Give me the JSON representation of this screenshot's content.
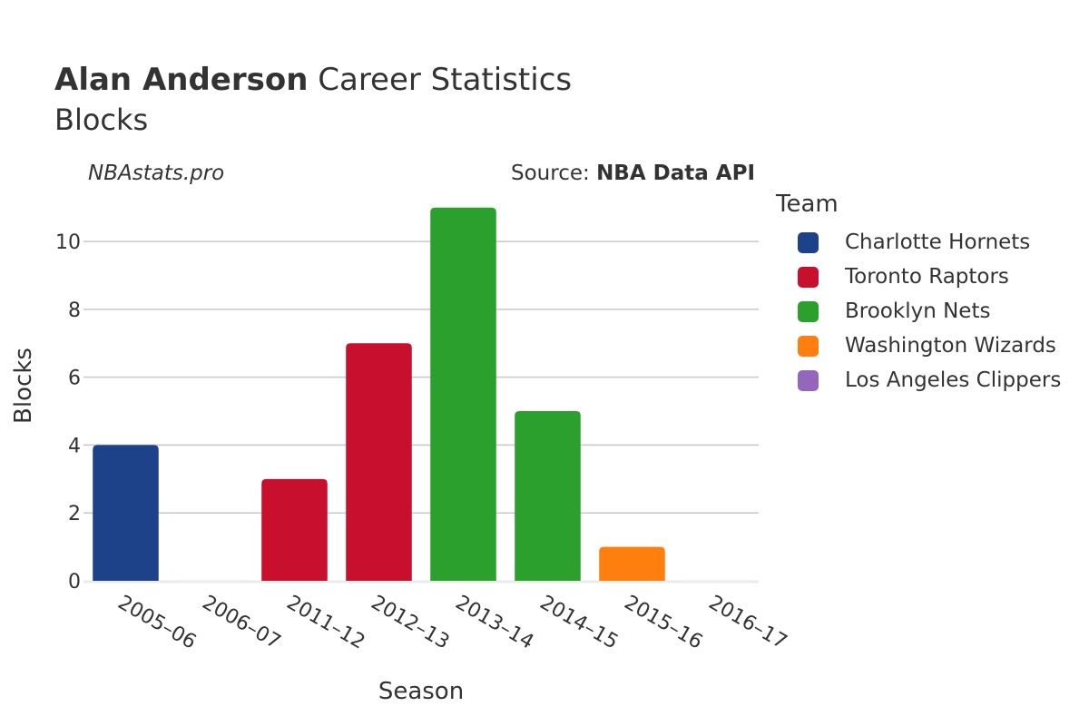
{
  "header": {
    "player": "Alan Anderson",
    "title_rest": " Career Statistics",
    "subtitle": "Blocks",
    "credit": "NBAstats.pro",
    "source_prefix": "Source: ",
    "source_name": "NBA Data API"
  },
  "legend": {
    "title": "Team",
    "items": [
      {
        "label": "Charlotte Hornets",
        "color": "#1d428a"
      },
      {
        "label": "Toronto Raptors",
        "color": "#c8102e"
      },
      {
        "label": "Brooklyn Nets",
        "color": "#2ca02c"
      },
      {
        "label": "Washington Wizards",
        "color": "#ff7f0e"
      },
      {
        "label": "Los Angeles Clippers",
        "color": "#9467bd"
      }
    ]
  },
  "chart_data": {
    "type": "bar",
    "title": "Alan Anderson Career Statistics",
    "subtitle": "Blocks",
    "xlabel": "Season",
    "ylabel": "Blocks",
    "ylim": [
      0,
      11.5
    ],
    "yticks": [
      0,
      2,
      4,
      6,
      8,
      10
    ],
    "grid": true,
    "legend_position": "right",
    "categories": [
      "2005–06",
      "2006–07",
      "2011–12",
      "2012–13",
      "2013–14",
      "2014–15",
      "2015–16",
      "2016–17"
    ],
    "values": [
      4,
      0,
      3,
      7,
      11,
      5,
      1,
      0
    ],
    "teams": [
      "Charlotte Hornets",
      "Charlotte Hornets",
      "Toronto Raptors",
      "Toronto Raptors",
      "Brooklyn Nets",
      "Brooklyn Nets",
      "Washington Wizards",
      "Los Angeles Clippers"
    ]
  }
}
